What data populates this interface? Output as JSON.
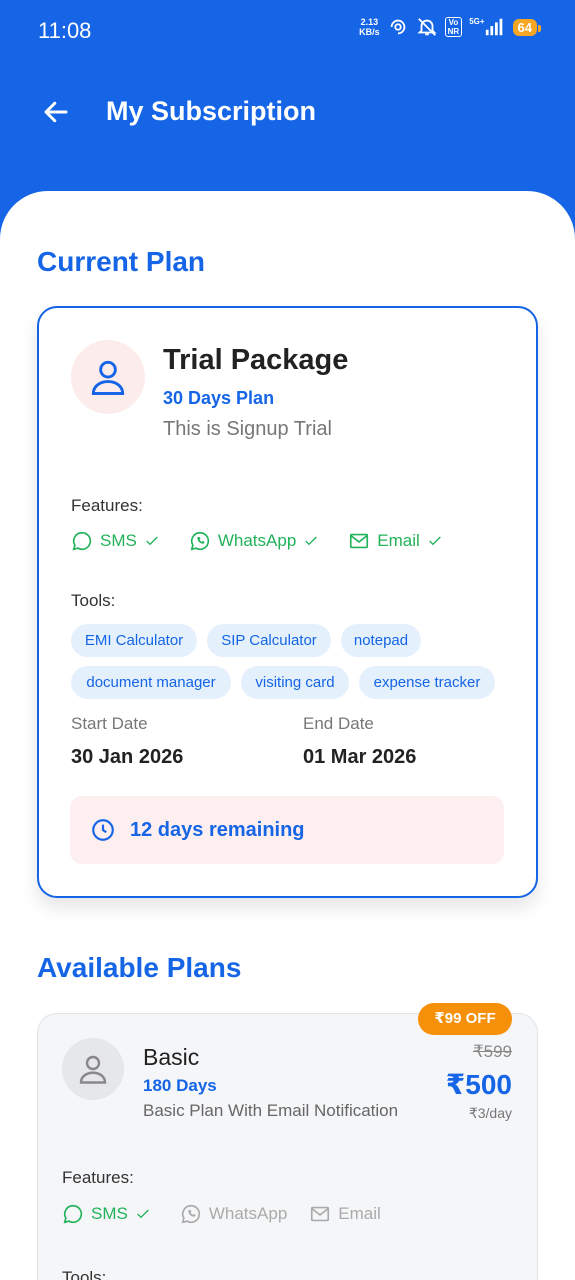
{
  "status": {
    "time": "11:08",
    "net_speed_value": "2.13",
    "net_speed_unit": "KB/s",
    "volte_top": "Vo",
    "volte_bottom": "NR",
    "network": "5G+",
    "battery": "64"
  },
  "appbar": {
    "title": "My Subscription"
  },
  "current": {
    "section_title": "Current Plan",
    "plan_name": "Trial Package",
    "plan_duration": "30 Days Plan",
    "plan_desc": "This is Signup Trial",
    "features_label": "Features:",
    "features": [
      {
        "label": "SMS",
        "enabled": true
      },
      {
        "label": "WhatsApp",
        "enabled": true
      },
      {
        "label": "Email",
        "enabled": true
      }
    ],
    "tools_label": "Tools:",
    "tools": [
      "EMI Calculator",
      "SIP Calculator",
      "notepad",
      "document manager",
      "visiting card",
      "expense tracker"
    ],
    "start_label": "Start Date",
    "start_date": "30 Jan 2026",
    "end_label": "End Date",
    "end_date": "01 Mar 2026",
    "remaining": "12 days remaining"
  },
  "available": {
    "section_title": "Available Plans",
    "plans": [
      {
        "name": "Basic",
        "duration": "180 Days",
        "desc": "Basic Plan With Email Notification",
        "discount_badge": "₹99 OFF",
        "old_price": "₹599",
        "price": "₹500",
        "per_day": "₹3/day",
        "features_label": "Features:",
        "features": [
          {
            "label": "SMS",
            "enabled": true
          },
          {
            "label": "WhatsApp",
            "enabled": false
          },
          {
            "label": "Email",
            "enabled": false
          }
        ],
        "tools_label": "Tools:"
      }
    ]
  },
  "colors": {
    "primary": "#1565e6",
    "feature_on": "#22b25a",
    "badge": "#f79009"
  }
}
